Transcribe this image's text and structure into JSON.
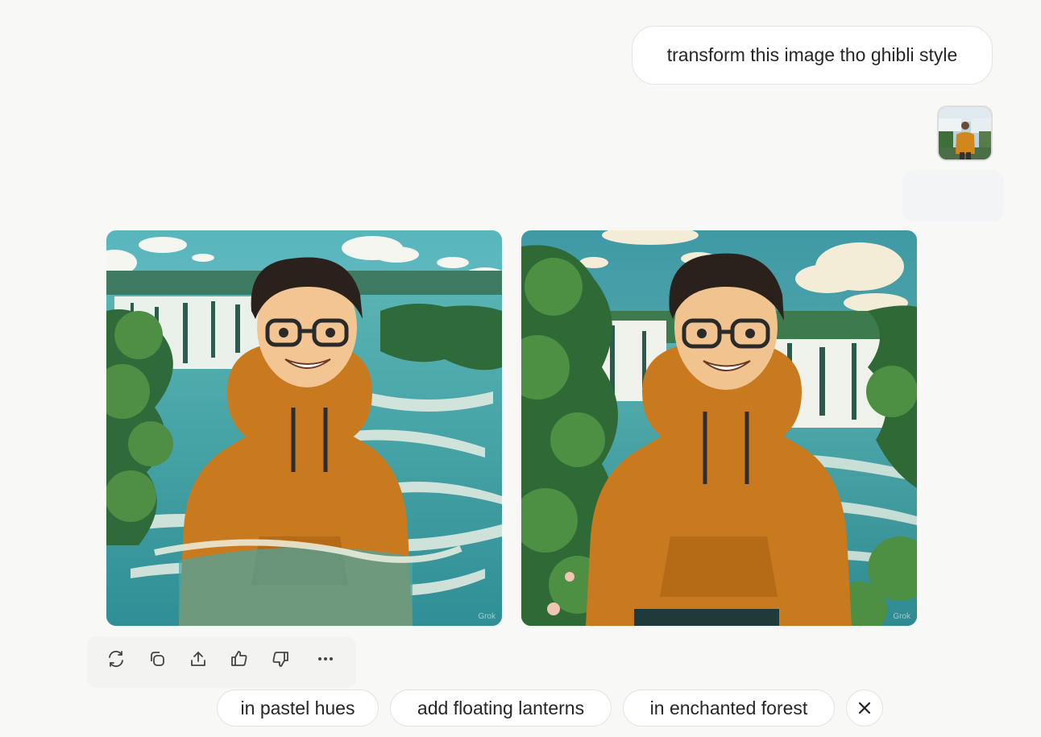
{
  "user_message": {
    "text": "transform this image tho ghibli style",
    "attachment_icon": "photo-thumbnail"
  },
  "generated_images": [
    {
      "label": "ghibli-image-1",
      "watermark": "Grok"
    },
    {
      "label": "ghibli-image-2",
      "watermark": "Grok"
    }
  ],
  "actions": [
    {
      "name": "regenerate",
      "icon": "refresh-icon"
    },
    {
      "name": "copy",
      "icon": "copy-icon"
    },
    {
      "name": "share",
      "icon": "share-icon"
    },
    {
      "name": "like",
      "icon": "thumbs-up-icon"
    },
    {
      "name": "dislike",
      "icon": "thumbs-down-icon"
    },
    {
      "name": "more",
      "icon": "more-icon"
    }
  ],
  "suggestions": [
    "in pastel hues",
    "add floating lanterns",
    "in enchanted forest"
  ],
  "colors": {
    "background": "#f8f8f7",
    "hoodie": "#c97a1e",
    "water": "#3f9da4",
    "foliage": "#3c7a3c"
  }
}
